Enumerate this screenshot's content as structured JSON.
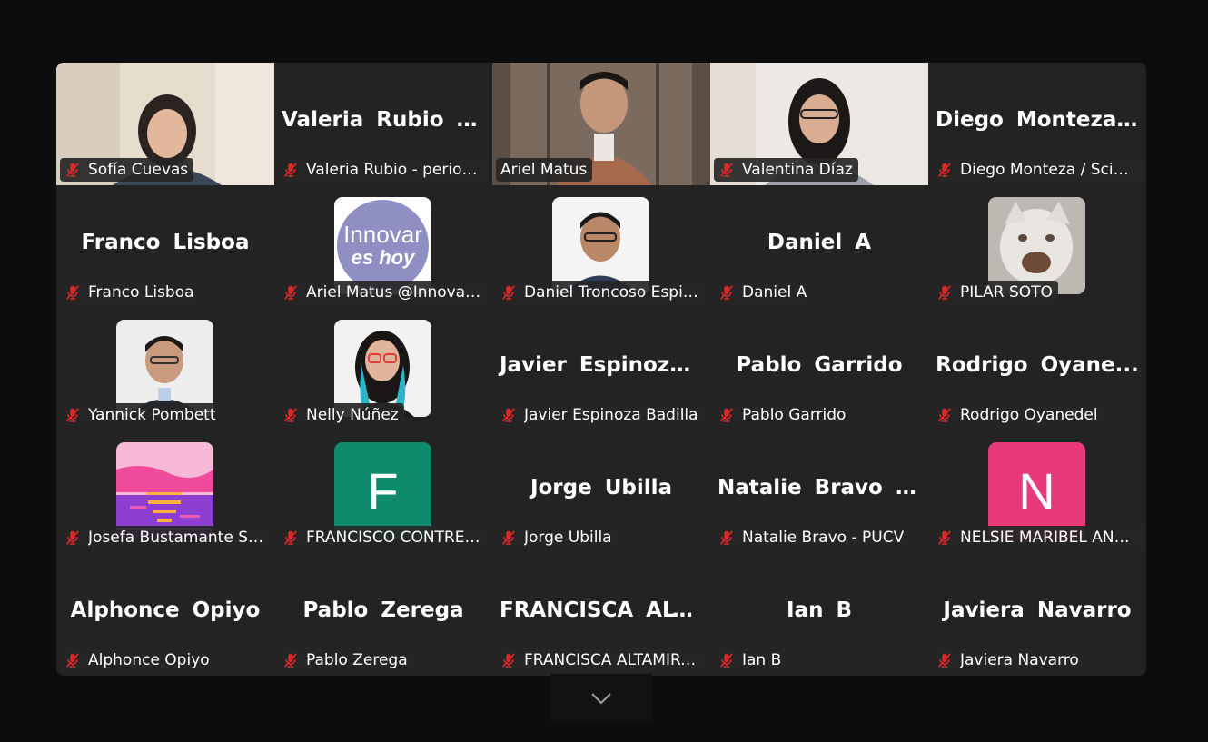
{
  "colors": {
    "active_speaker_border": "#23d96b",
    "muted_icon": "#e02828",
    "tile_bg": "#232323"
  },
  "participants": [
    {
      "label": "Sofía Cuevas",
      "display": "video",
      "muted": true
    },
    {
      "label": "Valeria Rubio - periodi...",
      "big_name": "Valeria  Rubio  -...",
      "display": "name",
      "muted": true
    },
    {
      "label": "Ariel Matus",
      "display": "video",
      "muted": false,
      "active_speaker": true
    },
    {
      "label": "Valentina Díaz",
      "display": "video",
      "muted": true
    },
    {
      "label": "Diego Monteza / Scien...",
      "big_name": "Diego  Monteza...",
      "display": "name",
      "muted": true
    },
    {
      "label": "Franco Lisboa",
      "big_name": "Franco Lisboa",
      "display": "name",
      "muted": true
    },
    {
      "label": "Ariel Matus @Innovar...",
      "display": "avatar",
      "avatar_text_1": "Innovar",
      "avatar_text_2": "es hoy",
      "muted": true
    },
    {
      "label": "Daniel Troncoso Espin...",
      "display": "avatar",
      "muted": true
    },
    {
      "label": "Daniel A",
      "big_name": "Daniel A",
      "display": "name",
      "muted": true
    },
    {
      "label": "PILAR SOTO",
      "display": "avatar",
      "muted": true
    },
    {
      "label": "Yannick Pombett",
      "display": "avatar",
      "muted": true
    },
    {
      "label": "Nelly Núñez",
      "display": "avatar",
      "muted": true
    },
    {
      "label": "Javier Espinoza Badilla",
      "big_name": "Javier  Espinoza...",
      "display": "name",
      "muted": true
    },
    {
      "label": "Pablo Garrido",
      "big_name": "Pablo Garrido",
      "display": "name",
      "muted": true
    },
    {
      "label": "Rodrigo Oyanedel",
      "big_name": "Rodrigo  Oyane...",
      "display": "name",
      "muted": true
    },
    {
      "label": "Josefa Bustamante Sal...",
      "display": "avatar",
      "muted": true
    },
    {
      "label": "FRANCISCO CONTRER...",
      "display": "avatar",
      "avatar_letter": "F",
      "muted": true
    },
    {
      "label": "Jorge Ubilla",
      "big_name": "Jorge Ubilla",
      "display": "name",
      "muted": true
    },
    {
      "label": "Natalie Bravo - PUCV",
      "big_name": "Natalie  Bravo  -...",
      "display": "name",
      "muted": true
    },
    {
      "label": "NELSIE MARIBEL AND...",
      "display": "avatar",
      "avatar_letter": "N",
      "muted": true
    },
    {
      "label": "Alphonce Opiyo",
      "big_name": "Alphonce Opiyo",
      "display": "name",
      "muted": true
    },
    {
      "label": "Pablo Zerega",
      "big_name": "Pablo Zerega",
      "display": "name",
      "muted": true
    },
    {
      "label": "FRANCISCA ALTAMIRA...",
      "big_name": "FRANCISCA  ALT...",
      "display": "name",
      "muted": true
    },
    {
      "label": "Ian B",
      "big_name": "Ian B",
      "display": "name",
      "muted": true
    },
    {
      "label": "Javiera Navarro",
      "big_name": "Javiera Navarro",
      "display": "name",
      "muted": true
    }
  ],
  "controls": {
    "scroll_icon": "chevron-down-icon"
  }
}
